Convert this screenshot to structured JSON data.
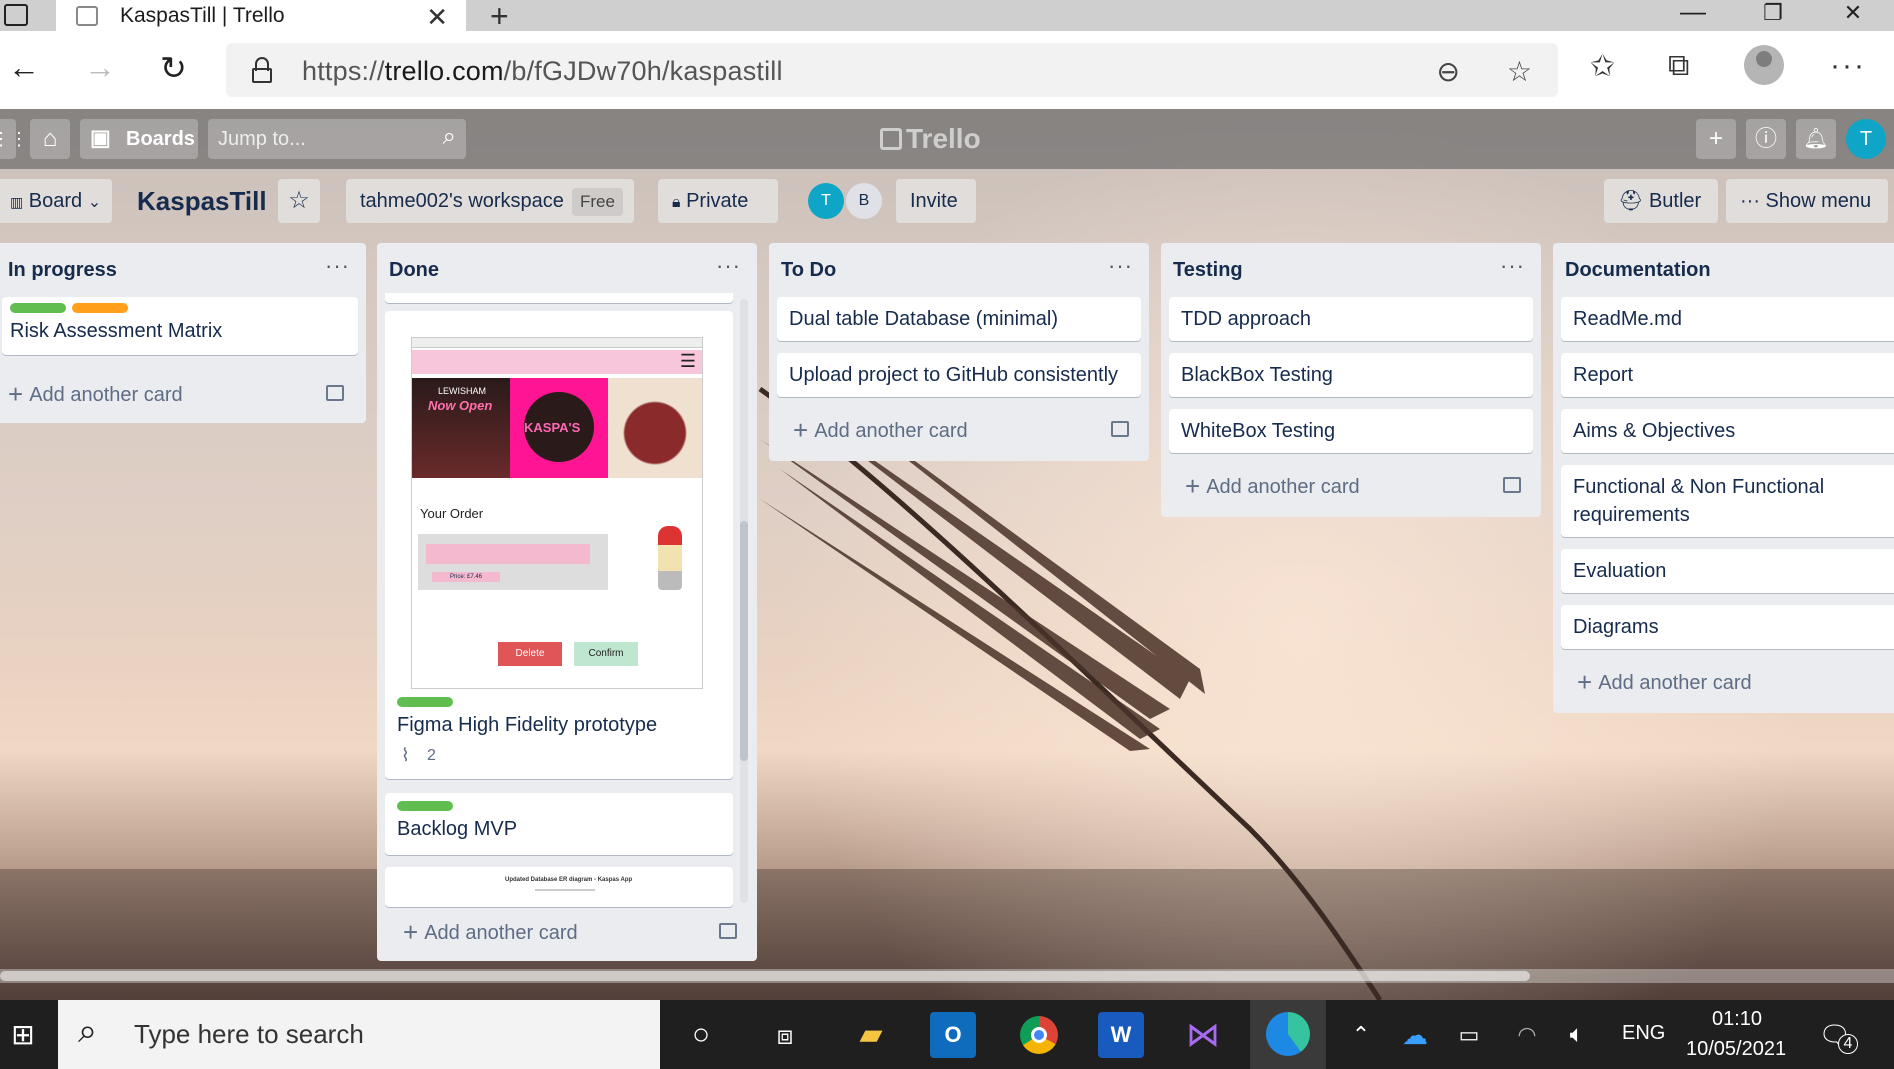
{
  "browser": {
    "tab_title": "KaspasTill | Trello",
    "url_prefix": "https://",
    "url_host": "trello.com",
    "url_path": "/b/fGJDw70h/kaspastill"
  },
  "trello_header": {
    "boards_label": "Boards",
    "search_placeholder": "Jump to...",
    "logo_text": "Trello",
    "user_initial": "T"
  },
  "board_header": {
    "board_menu_label": "Board",
    "board_name": "KaspasTill",
    "workspace_label": "tahme002's workspace",
    "workspace_badge": "Free",
    "visibility_label": "Private",
    "members": [
      "T",
      "B"
    ],
    "invite_label": "Invite",
    "butler_label": "Butler",
    "show_menu_label": "Show menu"
  },
  "lists": [
    {
      "title": "In progress",
      "cards": [
        {
          "title": "Risk Assessment Matrix",
          "labels": [
            "#61bd4f",
            "#ff9f1a"
          ]
        }
      ],
      "add_label": "Add another card"
    },
    {
      "title": "Done",
      "cards": [
        {
          "title": "Figma High Fidelity prototype",
          "labels": [
            "#61bd4f"
          ],
          "attachments": "2",
          "preview": {
            "banner_text_1": "LEWISHAM",
            "banner_text_2": "Now Open",
            "logo_text": "KASPA'S",
            "heading": "Your Order",
            "price_text": "Price: £7.46",
            "delete_label": "Delete",
            "confirm_label": "Confirm"
          }
        },
        {
          "title": "Backlog MVP",
          "labels": [
            "#61bd4f"
          ]
        },
        {
          "preview_caption": "Updated Database ER diagram - Kaspas App"
        }
      ],
      "add_label": "Add another card"
    },
    {
      "title": "To Do",
      "cards": [
        {
          "title": "Dual table Database (minimal)"
        },
        {
          "title": "Upload project to GitHub consistently"
        }
      ],
      "add_label": "Add another card"
    },
    {
      "title": "Testing",
      "cards": [
        {
          "title": "TDD approach"
        },
        {
          "title": "BlackBox Testing"
        },
        {
          "title": "WhiteBox Testing"
        }
      ],
      "add_label": "Add another card"
    },
    {
      "title": "Documentation",
      "cards": [
        {
          "title": "ReadMe.md"
        },
        {
          "title": "Report"
        },
        {
          "title": "Aims & Objectives"
        },
        {
          "title": "Functional & Non Functional requirements"
        },
        {
          "title": "Evaluation"
        },
        {
          "title": "Diagrams"
        }
      ],
      "add_label": "Add another card"
    }
  ],
  "taskbar": {
    "search_placeholder": "Type here to search",
    "language": "ENG",
    "time": "01:10",
    "date": "10/05/2021",
    "notification_count": "4"
  },
  "colors": {
    "list_bg": "#ebecf0",
    "label_green": "#61bd4f",
    "label_orange": "#ff9f1a",
    "user_avatar": "#0ea5c6"
  }
}
